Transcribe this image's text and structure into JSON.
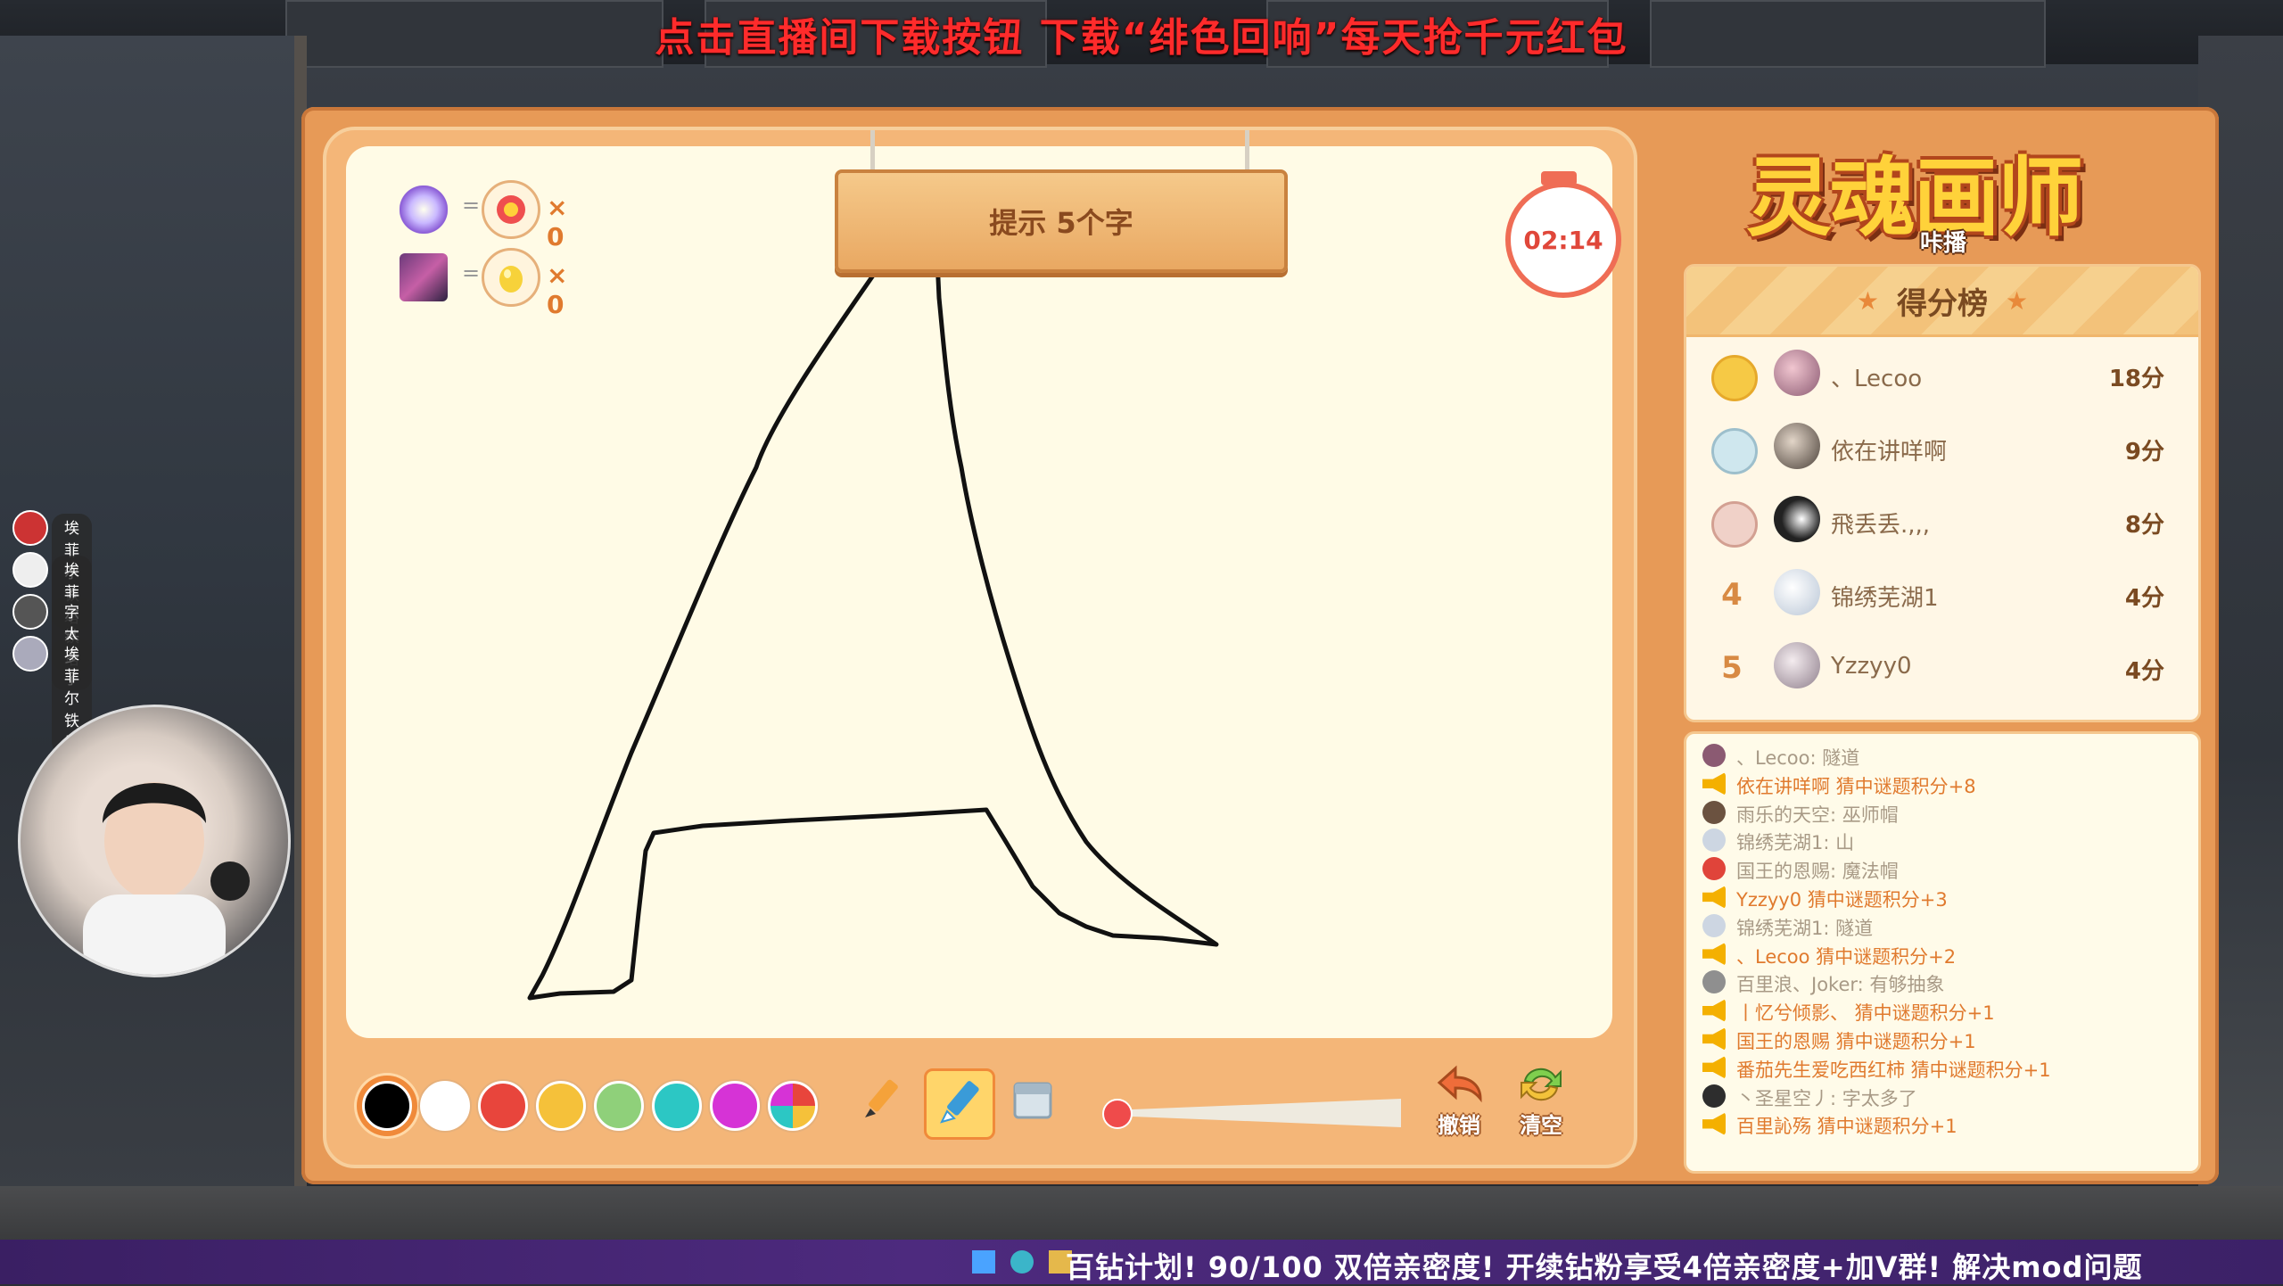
{
  "banner": "点击直播间下载按钮 下载“绯色回响”每天抢千元红包",
  "hint": {
    "label": "提示 5个字"
  },
  "timer": {
    "value": "02:14"
  },
  "indicators": [
    {
      "eq": "=",
      "count": "× 0"
    },
    {
      "eq": "=",
      "count": "× 0"
    }
  ],
  "palette": [
    "#000000",
    "#ffffff",
    "#e8453c",
    "#f5c13a",
    "#8fd07a",
    "#2cc7c4",
    "#d633d6",
    "rainbow"
  ],
  "tools": {
    "undo": "撤销",
    "clear": "清空"
  },
  "logo": {
    "title": "灵魂画师",
    "sub": "咔播"
  },
  "scoreboard": {
    "title": "得分榜",
    "rows": [
      {
        "rank": "",
        "medal": "gold",
        "name": "、Lecoo",
        "score": "18分"
      },
      {
        "rank": "",
        "medal": "silver",
        "name": "依在讲咩啊",
        "score": "9分"
      },
      {
        "rank": "",
        "medal": "bronze",
        "name": "飛丢丢.,,,",
        "score": "8分"
      },
      {
        "rank": "4",
        "medal": "",
        "name": "锦绣芜湖1",
        "score": "4分"
      },
      {
        "rank": "5",
        "medal": "",
        "name": "Yzzyy0",
        "score": "4分"
      }
    ]
  },
  "chat": [
    {
      "type": "usr",
      "text": "、Lecoo: 隧道"
    },
    {
      "type": "sys",
      "text": "依在讲咩啊 猜中谜题积分+8"
    },
    {
      "type": "usr",
      "text": "雨乐的天空: 巫师帽"
    },
    {
      "type": "usr",
      "text": "锦绣芜湖1: 山"
    },
    {
      "type": "usr",
      "text": "国王的恩赐: 魔法帽"
    },
    {
      "type": "sys",
      "text": "Yzzyy0 猜中谜题积分+3"
    },
    {
      "type": "usr",
      "text": "锦绣芜湖1: 隧道"
    },
    {
      "type": "sys",
      "text": "、Lecoo 猜中谜题积分+2"
    },
    {
      "type": "usr",
      "text": "百里浪、Joker: 有够抽象"
    },
    {
      "type": "sys",
      "text": "丨忆兮倾影、 猜中谜题积分+1"
    },
    {
      "type": "sys",
      "text": "国王的恩赐 猜中谜题积分+1"
    },
    {
      "type": "sys",
      "text": "番茄先生爱吃西红柿 猜中谜题积分+1"
    },
    {
      "type": "usr",
      "text": "丶圣星空丿: 字太多了"
    },
    {
      "type": "sys",
      "text": "百里訫殇 猜中谜题积分+1"
    }
  ],
  "viewers": [
    "埃菲尔铁塔",
    "埃菲尔铁塔",
    "字太多了",
    "埃菲尔铁塔"
  ],
  "taskbar": {
    "text": "百钻计划! 90/100  双倍亲密度! 开续钻粉享受4倍亲密度+加V群! 解决mod问题"
  },
  "colors": {
    "frame": "#e79a57",
    "board": "#fffbe6",
    "accent": "#f08a3a"
  }
}
